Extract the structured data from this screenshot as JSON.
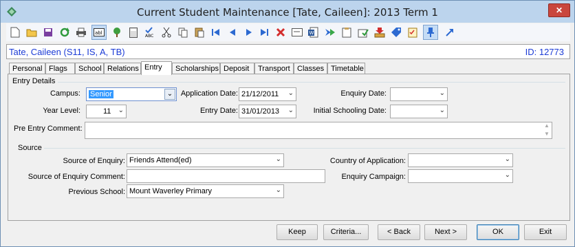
{
  "window": {
    "title": "Current Student Maintenance  [Tate, Caileen]:  2013 Term 1",
    "close_label": "✕"
  },
  "toolbar": {
    "icons": [
      "new-document-icon",
      "open-folder-icon",
      "save-icon",
      "refresh-icon",
      "print-icon",
      "text-field-icon",
      "tree-icon",
      "calculator-icon",
      "spell-check-icon",
      "cut-icon",
      "copy-icon",
      "paste-icon",
      "first-record-icon",
      "previous-record-icon",
      "next-record-icon",
      "last-record-icon",
      "delete-icon",
      "card-icon",
      "word-document-icon",
      "export-icon",
      "clipboard-icon",
      "approve-icon",
      "download-icon",
      "tag-icon",
      "checklist-icon",
      "pin-icon",
      "arrow-up-right-icon"
    ]
  },
  "student": {
    "name": "Tate, Caileen (S11, IS, A, TB)",
    "id": "ID: 12773"
  },
  "tabs": [
    "Personal",
    "Flags",
    "School",
    "Relations",
    "Entry",
    "Scholarships",
    "Deposit",
    "Transport",
    "Classes",
    "Timetable"
  ],
  "entry": {
    "group_label": "Entry Details",
    "campus_label": "Campus:",
    "campus_value": "Senior",
    "application_date_label": "Application Date:",
    "application_date_value": "21/12/2011",
    "enquiry_date_label": "Enquiry Date:",
    "enquiry_date_value": "",
    "year_level_label": "Year Level:",
    "year_level_value": "11",
    "entry_date_label": "Entry Date:",
    "entry_date_value": "31/01/2013",
    "initial_schooling_label": "Initial Schooling Date:",
    "initial_schooling_value": "",
    "pre_entry_label": "Pre Entry Comment:",
    "pre_entry_value": ""
  },
  "source": {
    "group_label": "Source",
    "source_enquiry_label": "Source of Enquiry:",
    "source_enquiry_value": "Friends Attend(ed)",
    "source_comment_label": "Source of Enquiry Comment:",
    "source_comment_value": "",
    "previous_school_label": "Previous School:",
    "previous_school_value": "Mount Waverley Primary",
    "country_label": "Country of Application:",
    "country_value": "",
    "campaign_label": "Enquiry Campaign:",
    "campaign_value": ""
  },
  "buttons": {
    "keep": "Keep",
    "criteria": "Criteria...",
    "back": "< Back",
    "next": "Next >",
    "ok": "OK",
    "exit": "Exit"
  }
}
